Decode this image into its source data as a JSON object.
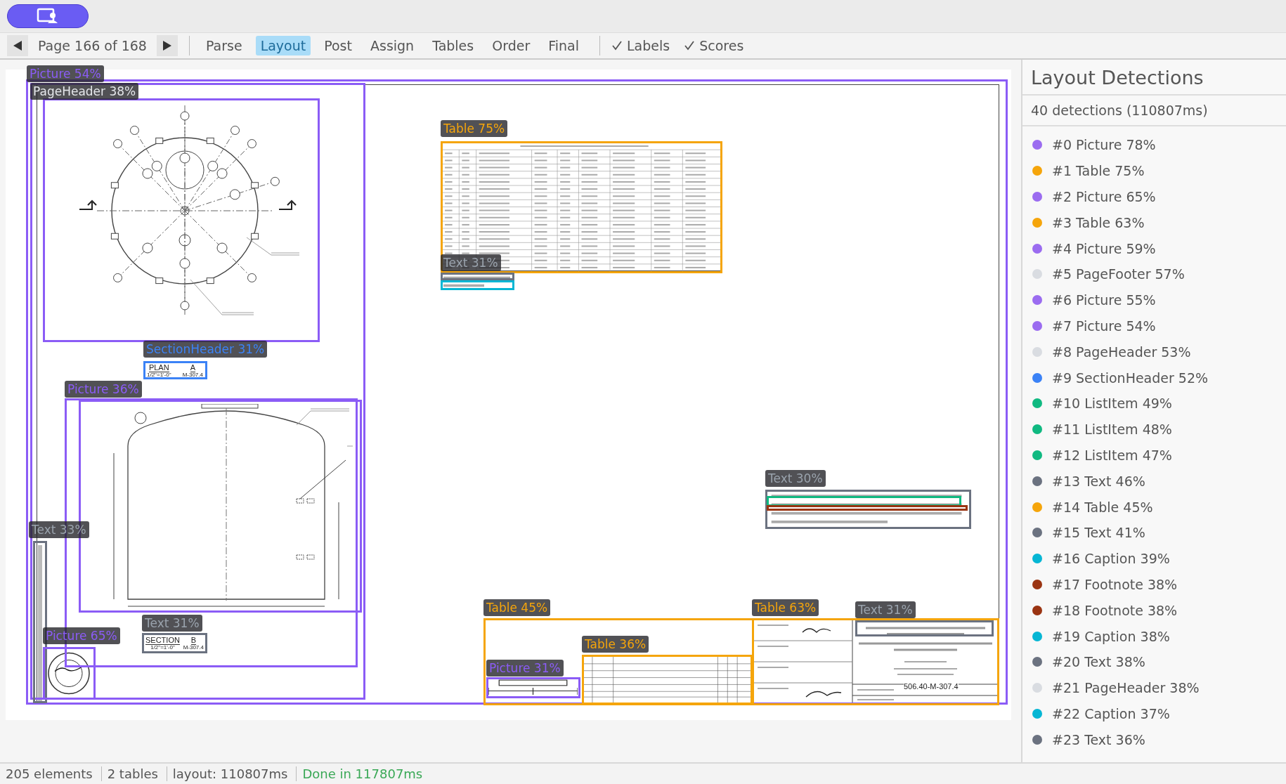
{
  "toolbar": {
    "page": "Page 166 of 168",
    "tabs": [
      {
        "label": "Parse",
        "selected": false
      },
      {
        "label": "Layout",
        "selected": true
      },
      {
        "label": "Post",
        "selected": false
      },
      {
        "label": "Assign",
        "selected": false
      },
      {
        "label": "Tables",
        "selected": false
      },
      {
        "label": "Order",
        "selected": false
      },
      {
        "label": "Final",
        "selected": false
      }
    ],
    "toggles": [
      {
        "label": "Labels",
        "checked": true
      },
      {
        "label": "Scores",
        "checked": true
      }
    ]
  },
  "sheet": {
    "boxes": [
      {
        "color": "#8b5cf6"
      },
      {
        "color": "#8b5cf6"
      },
      {
        "color": "#8b5cf6"
      },
      {
        "color": "#3b82f6"
      },
      {
        "color": "#8b5cf6"
      },
      {
        "color": "#8b5cf6"
      },
      {
        "color": "#6b7280"
      },
      {
        "color": "#6b7280"
      },
      {
        "color": "#8b5cf6"
      },
      {
        "color": "#f5a50b"
      },
      {
        "color": "#6b7280"
      },
      {
        "color": "#06b6d4"
      },
      {
        "color": "#6b7280"
      },
      {
        "color": "#10b981"
      },
      {
        "color": "#9a3412"
      },
      {
        "color": "#f5a50b"
      },
      {
        "color": "#f5a50b"
      },
      {
        "color": "#8b5cf6"
      },
      {
        "color": "#f5a50b"
      },
      {
        "color": "#6b7280"
      }
    ],
    "labels": [
      {
        "text": "Picture 54%",
        "kind": "picture"
      },
      {
        "text": "PageHeader 38%",
        "kind": "header"
      },
      {
        "text": "SectionHeader 31%",
        "kind": "section"
      },
      {
        "text": "Picture 36%",
        "kind": "picture"
      },
      {
        "text": "Text 33%",
        "kind": "text"
      },
      {
        "text": "Text 31%",
        "kind": "text"
      },
      {
        "text": "Picture 65%",
        "kind": "picture"
      },
      {
        "text": "Table 75%",
        "kind": "table"
      },
      {
        "text": "Text 31%",
        "kind": "text"
      },
      {
        "text": "Text 30%",
        "kind": "text"
      },
      {
        "text": "Table 45%",
        "kind": "table"
      },
      {
        "text": "Table 36%",
        "kind": "table"
      },
      {
        "text": "Picture 31%",
        "kind": "picture"
      },
      {
        "text": "Table 63%",
        "kind": "table"
      },
      {
        "text": "Text 31%",
        "kind": "text"
      }
    ],
    "captions": [
      {
        "title": "PLAN",
        "scale": "1/2\"=1'-0\"",
        "key": "A",
        "sheet": "M-307.4"
      },
      {
        "title": "SECTION",
        "scale": "1/2\"=1'-0\"",
        "key": "B",
        "sheet": "M-307.4"
      }
    ],
    "drawing_number": "506.40-M-307.4"
  },
  "panel": {
    "title": "Layout Detections",
    "summary": "40 detections (110807ms)",
    "items": [
      {
        "label": "#0 Picture 78%",
        "color": "#9b6cf0"
      },
      {
        "label": "#1 Table 75%",
        "color": "#f5a50b"
      },
      {
        "label": "#2 Picture 65%",
        "color": "#9b6cf0"
      },
      {
        "label": "#3 Table 63%",
        "color": "#f5a50b"
      },
      {
        "label": "#4 Picture 59%",
        "color": "#9b6cf0"
      },
      {
        "label": "#5 PageFooter 57%",
        "color": "#d9dce1"
      },
      {
        "label": "#6 Picture 55%",
        "color": "#9b6cf0"
      },
      {
        "label": "#7 Picture 54%",
        "color": "#9b6cf0"
      },
      {
        "label": "#8 PageHeader 53%",
        "color": "#d9dce1"
      },
      {
        "label": "#9 SectionHeader 52%",
        "color": "#3b82f6"
      },
      {
        "label": "#10 ListItem 49%",
        "color": "#10b981"
      },
      {
        "label": "#11 ListItem 48%",
        "color": "#10b981"
      },
      {
        "label": "#12 ListItem 47%",
        "color": "#10b981"
      },
      {
        "label": "#13 Text 46%",
        "color": "#6b7280"
      },
      {
        "label": "#14 Table 45%",
        "color": "#f5a50b"
      },
      {
        "label": "#15 Text 41%",
        "color": "#6b7280"
      },
      {
        "label": "#16 Caption 39%",
        "color": "#06b6d4"
      },
      {
        "label": "#17 Footnote 38%",
        "color": "#9a3412"
      },
      {
        "label": "#18 Footnote 38%",
        "color": "#9a3412"
      },
      {
        "label": "#19 Caption 38%",
        "color": "#06b6d4"
      },
      {
        "label": "#20 Text 38%",
        "color": "#6b7280"
      },
      {
        "label": "#21 PageHeader 38%",
        "color": "#d9dce1"
      },
      {
        "label": "#22 Caption 37%",
        "color": "#06b6d4"
      },
      {
        "label": "#23 Text 36%",
        "color": "#6b7280"
      }
    ]
  },
  "status_bar": [
    {
      "text": "205 elements",
      "kind": "plain"
    },
    {
      "text": "2 tables",
      "kind": "plain"
    },
    {
      "text": "layout: 110807ms",
      "kind": "plain"
    },
    {
      "text": "Done in 117807ms",
      "kind": "success"
    }
  ]
}
